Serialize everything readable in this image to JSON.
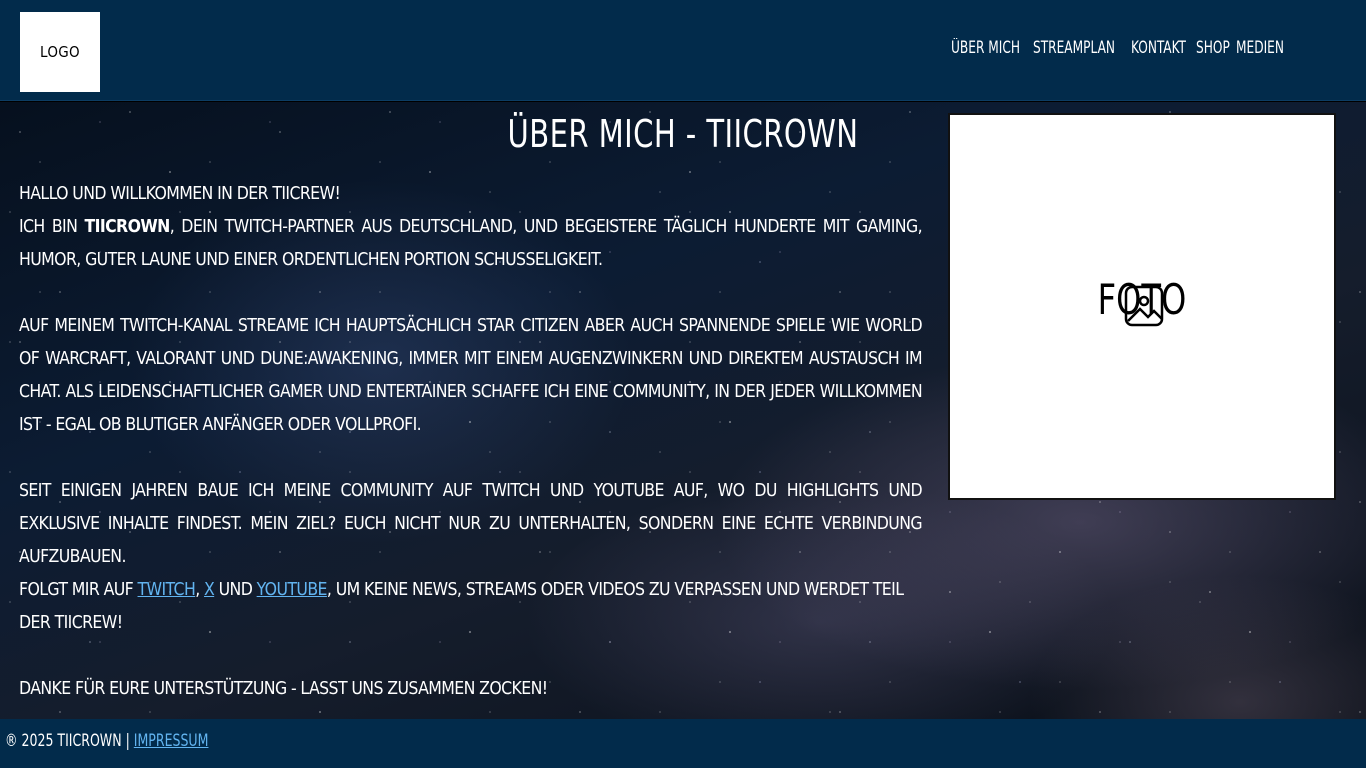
{
  "header": {
    "logo_text": "Logo",
    "nav": [
      {
        "label": "Über mich"
      },
      {
        "label": "Streamplan"
      },
      {
        "label": "Kontakt"
      },
      {
        "label": "Shop"
      },
      {
        "label": "Medien"
      }
    ]
  },
  "main": {
    "title": "Über mich - TiiCrown",
    "greeting": "Hallo und willkommen in der TiiCrew!",
    "intro_prefix": "Ich bin ",
    "intro_name": "TiiCrown",
    "intro_suffix": ", dein Twitch-Partner aus Deutschland, und begeistere täglich Hunderte mit Gaming, Humor, guter Laune und einer ordentlichen Portion Schusseligkeit.",
    "para2": "Auf meinem Twitch-Kanal streame ich hauptsächlich Star Citizen aber auch spannende Spiele wie World of Warcraft, Valorant und Dune:Awakening, immer mit einem Augenzwinkern und direktem Austausch im Chat. Als leidenschaftlicher Gamer und Entertainer schaffe ich eine Community, in der jeder willkommen ist - egal ob blutiger Anfänger oder Vollprofi.",
    "para3": "Seit einigen Jahren baue ich meine Community auf Twitch und YouTube auf, wo du Highlights und exklusive Inhalte findest. Mein Ziel? Euch nicht nur zu unterhalten, sondern eine echte Verbindung aufzubauen.",
    "follow_prefix": "Folgt mir auf ",
    "link_twitch": "Twitch",
    "sep1": ", ",
    "link_x": "X",
    "follow_and": " und ",
    "link_youtube": "YouTube",
    "follow_suffix": ", um keine News, Streams oder Videos zu verpassen und werdet Teil der TiiCrew!",
    "thanks": "Danke für eure Unterstützung - lasst uns zusammen zocken!",
    "photo_label": "Foto",
    "photo_icon": "image-icon"
  },
  "footer": {
    "copyright": "® 2025 TiiCrown | ",
    "impressum": "Impressum"
  },
  "colors": {
    "header_bg": "#022b4b",
    "link": "#62b4f0"
  }
}
